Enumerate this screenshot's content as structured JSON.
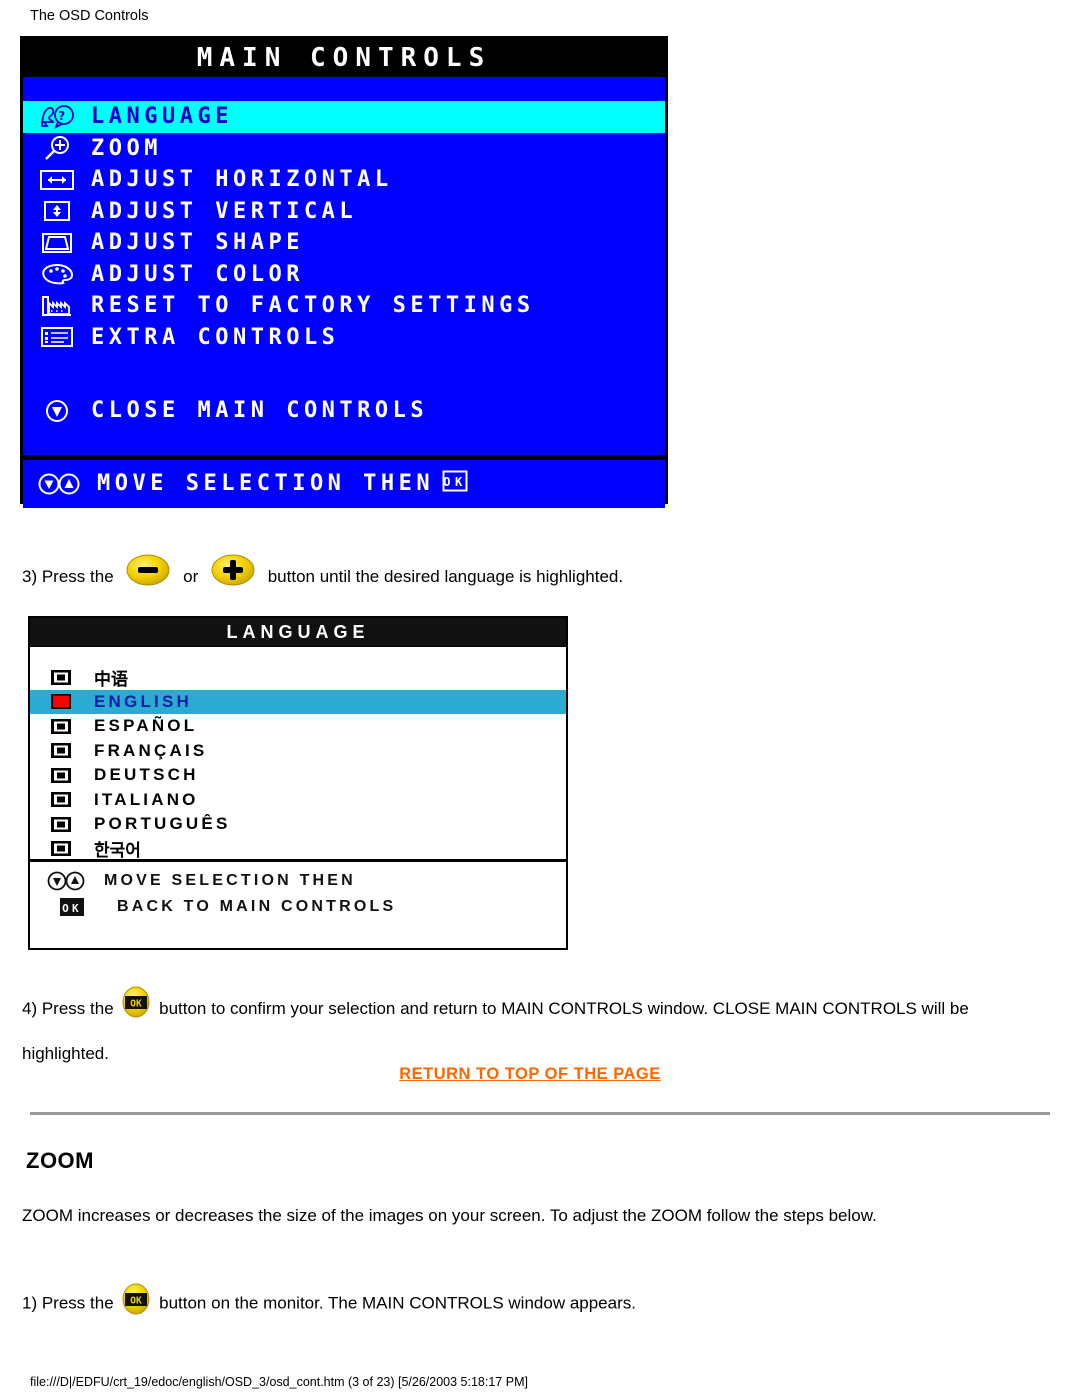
{
  "page": {
    "running_head": "The OSD Controls",
    "footer": "file:///D|/EDFU/crt_19/edoc/english/OSD_3/osd_cont.htm (3 of 23) [5/26/2003 5:18:17 PM]"
  },
  "colors": {
    "osd_blue": "#0000FF",
    "osd_highlight_cyan": "#00FFFF",
    "osd_black": "#000000",
    "osd_white": "#FFFFFF",
    "language_highlight_teal": "#2AABD2",
    "language_highlight_text": "#0B1EA8",
    "radio_selected_red": "#FF0000",
    "button_yellow": "#FFD700",
    "link_orange": "#FF6600",
    "rule_gray": "#999999"
  },
  "main_controls_osd": {
    "title": "MAIN CONTROLS",
    "items": [
      {
        "label": "LANGUAGE",
        "icon": "face-question-icon",
        "highlighted": true
      },
      {
        "label": "ZOOM",
        "icon": "magnifier-plus-icon",
        "highlighted": false
      },
      {
        "label": "ADJUST HORIZONTAL",
        "icon": "horizontal-arrows-icon",
        "highlighted": false
      },
      {
        "label": "ADJUST VERTICAL",
        "icon": "vertical-arrows-icon",
        "highlighted": false
      },
      {
        "label": "ADJUST SHAPE",
        "icon": "trapezoid-shape-icon",
        "highlighted": false
      },
      {
        "label": "ADJUST COLOR",
        "icon": "color-palette-icon",
        "highlighted": false
      },
      {
        "label": "RESET TO FACTORY SETTINGS",
        "icon": "factory-icon",
        "highlighted": false
      },
      {
        "label": "EXTRA CONTROLS",
        "icon": "list-icon",
        "highlighted": false
      }
    ],
    "close_item": {
      "label": "CLOSE MAIN CONTROLS",
      "icon": "down-arrow-circle-icon"
    },
    "footer_hint": {
      "label": "MOVE SELECTION THEN",
      "icons": [
        "down-arrow-circle-icon",
        "up-arrow-circle-icon"
      ],
      "trailing_icon": "ok-box-icon"
    }
  },
  "step3": {
    "text_before": "3) Press the",
    "minus_icon": "minus-button-icon",
    "text_middle": "or",
    "plus_icon": "plus-button-icon",
    "text_after": "button until the desired language is highlighted."
  },
  "language_osd": {
    "title": "LANGUAGE",
    "items": [
      {
        "label": "中语",
        "selected": false,
        "script": "cjk"
      },
      {
        "label": "ENGLISH",
        "selected": true,
        "script": "latin"
      },
      {
        "label": "ESPAÑOL",
        "selected": false,
        "script": "latin"
      },
      {
        "label": "FRANÇAIS",
        "selected": false,
        "script": "latin"
      },
      {
        "label": "DEUTSCH",
        "selected": false,
        "script": "latin"
      },
      {
        "label": "ITALIANO",
        "selected": false,
        "script": "latin"
      },
      {
        "label": "PORTUGUÊS",
        "selected": false,
        "script": "latin"
      },
      {
        "label": "한국어",
        "selected": false,
        "script": "cjk"
      }
    ],
    "footer_lines": [
      {
        "label": "MOVE SELECTION THEN",
        "icons": [
          "down-arrow-circle-icon",
          "up-arrow-circle-icon"
        ]
      },
      {
        "label": "BACK TO MAIN CONTROLS",
        "icons": [
          "ok-box-icon"
        ]
      }
    ]
  },
  "step4": {
    "text_before": "4) Press the",
    "ok_icon": "ok-button-icon",
    "text_after": "button to confirm your selection and return to MAIN CONTROLS window. CLOSE MAIN CONTROLS will be highlighted."
  },
  "return_link": {
    "label": "RETURN TO TOP OF THE PAGE"
  },
  "zoom_section": {
    "heading": "ZOOM",
    "paragraph": "ZOOM increases or decreases the size of the images on your screen. To adjust the ZOOM follow the steps below.",
    "step1_before": "1) Press the",
    "step1_icon": "ok-button-icon",
    "step1_after": "button on the monitor. The MAIN CONTROLS window appears."
  }
}
